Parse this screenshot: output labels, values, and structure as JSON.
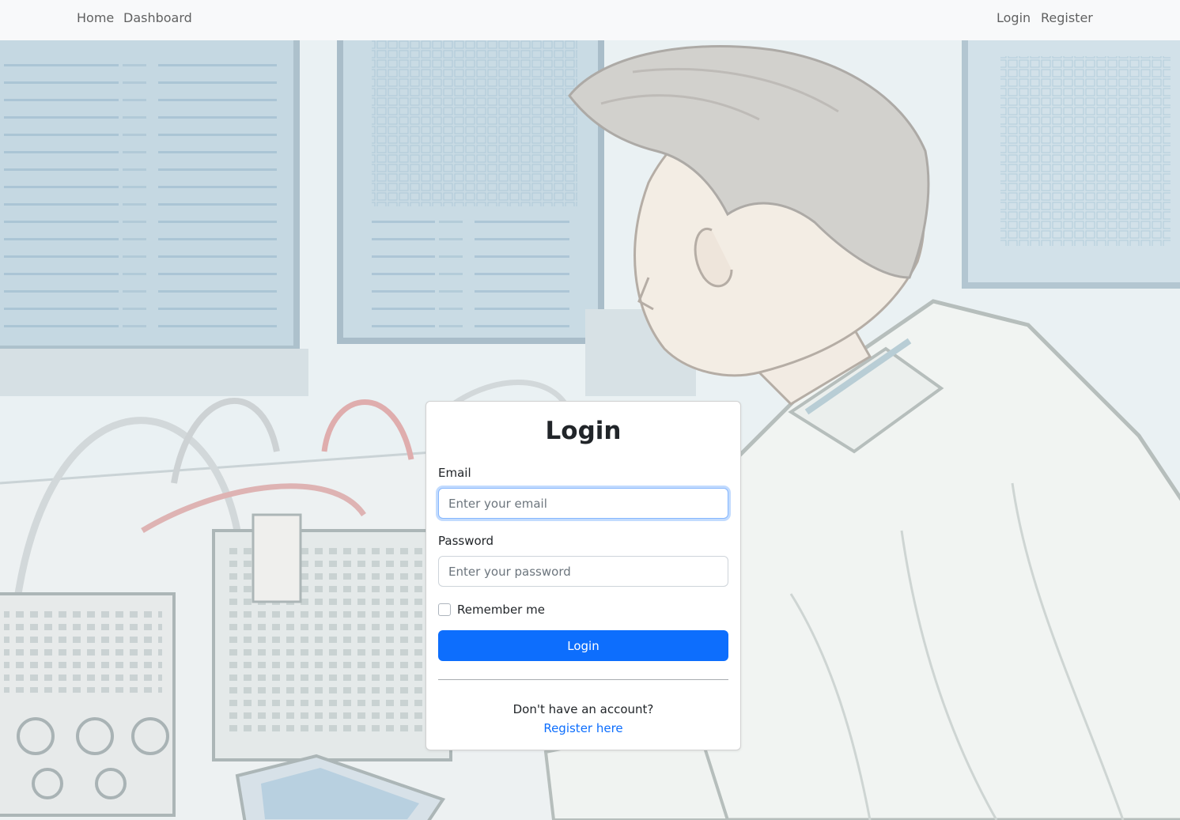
{
  "nav": {
    "home": "Home",
    "dashboard": "Dashboard",
    "login": "Login",
    "register": "Register"
  },
  "login_card": {
    "title": "Login",
    "email_label": "Email",
    "email_placeholder": "Enter your email",
    "email_value": "",
    "password_label": "Password",
    "password_placeholder": "Enter your password",
    "password_value": "",
    "remember_label": "Remember me",
    "remember_checked": false,
    "submit_label": "Login",
    "no_account_text": "Don't have an account?",
    "register_link": "Register here"
  },
  "colors": {
    "navbar_bg": "#f8f9fa",
    "primary": "#0d6efd",
    "focus_border": "#86b7fe",
    "card_bg": "#ffffff"
  },
  "background": {
    "icon": "engineer-at-workstation-illustration"
  }
}
